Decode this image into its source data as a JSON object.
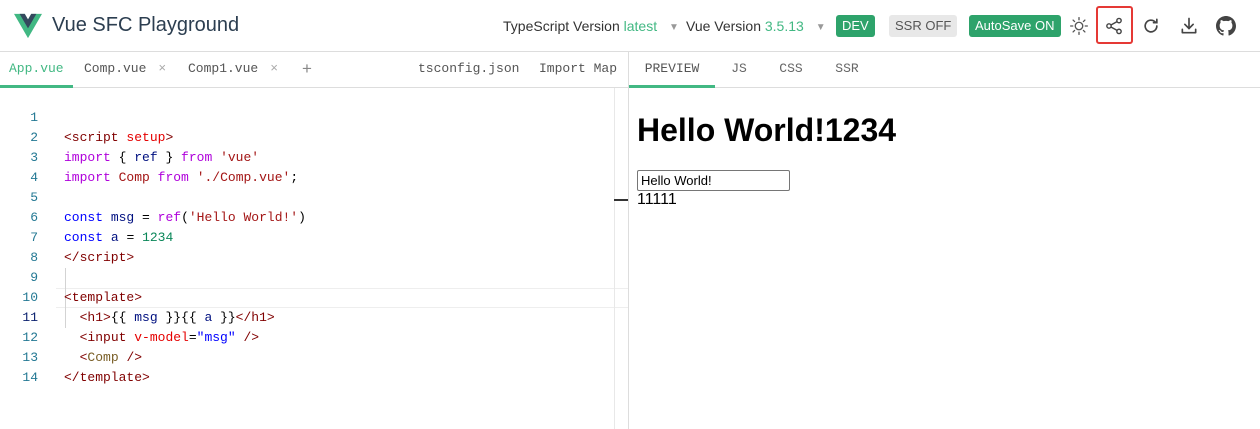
{
  "header": {
    "title": "Vue SFC Playground",
    "ts_label": "TypeScript Version",
    "ts_value": "latest",
    "vue_label": "Vue Version",
    "vue_value": "3.5.13",
    "dev_badge": "DEV",
    "ssr_badge": "SSR OFF",
    "autosave_badge": "AutoSave ON",
    "icons": [
      "vue-logo",
      "theme-toggle-icon",
      "share-icon",
      "reload-icon",
      "download-icon",
      "github-icon"
    ],
    "accent": "#42b883",
    "highlight": "#e53935"
  },
  "editor": {
    "tabs": [
      {
        "label": "App.vue",
        "active": true
      },
      {
        "label": "Comp.vue",
        "close": "×"
      },
      {
        "label": "Comp1.vue",
        "close": "×"
      }
    ],
    "add_tab": "+",
    "right_tabs": [
      "tsconfig.json",
      "Import Map"
    ],
    "line_numbers": [
      "1",
      "2",
      "3",
      "4",
      "5",
      "6",
      "7",
      "8",
      "9",
      "10",
      "11",
      "12",
      "13",
      "14"
    ]
  },
  "preview": {
    "tabs": [
      "PREVIEW",
      "JS",
      "CSS",
      "SSR"
    ],
    "heading": "Hello World!1234",
    "input_value": "Hello World!",
    "text": "11111"
  }
}
